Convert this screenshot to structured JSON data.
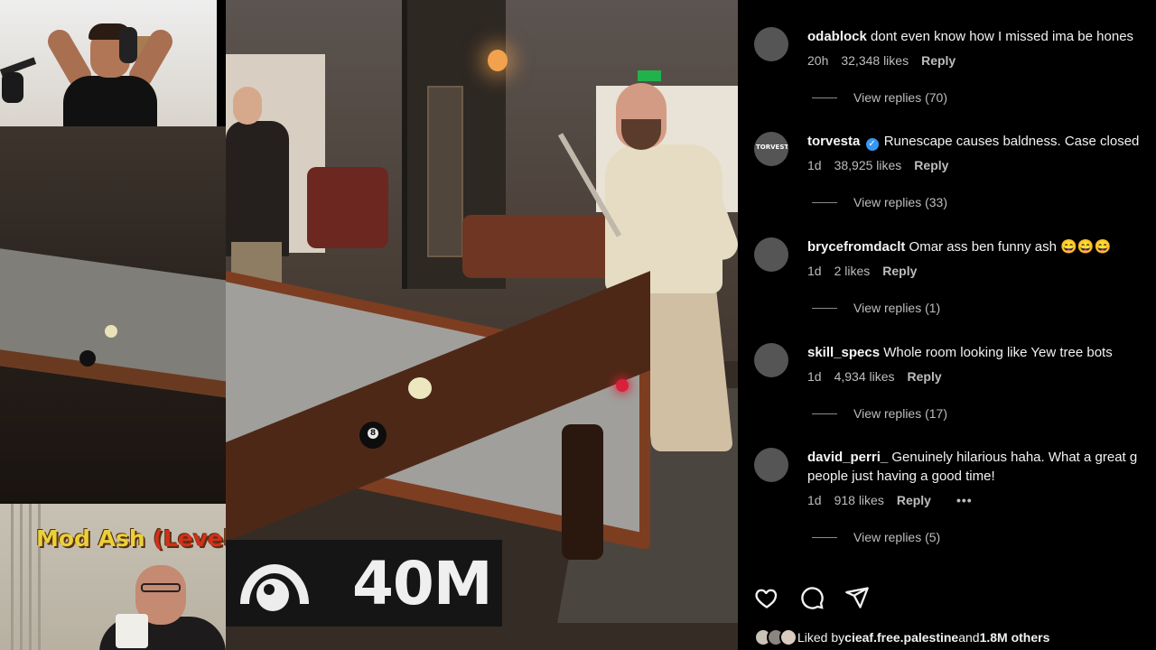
{
  "overlay": {
    "views_count": "40M",
    "mod_cam_title_main": "Mod Ash ",
    "mod_cam_title_accent": "(Level"
  },
  "comments": [
    {
      "username": "odablock",
      "verified": false,
      "text": "dont even know how I missed ima be hones",
      "time": "20h",
      "likes": "32,348 likes",
      "reply": "Reply",
      "view_replies": "View replies (70)"
    },
    {
      "username": "torvesta",
      "verified": true,
      "avatar_label": "TORVESTA",
      "text": "Runescape causes baldness. Case closed",
      "time": "1d",
      "likes": "38,925 likes",
      "reply": "Reply",
      "view_replies": "View replies (33)"
    },
    {
      "username": "brycefromdaclt",
      "verified": false,
      "text": "Omar ass ben funny ash 😄😄😄",
      "time": "1d",
      "likes": "2 likes",
      "reply": "Reply",
      "view_replies": "View replies (1)"
    },
    {
      "username": "skill_specs",
      "verified": false,
      "text": "Whole room looking like Yew tree bots",
      "time": "1d",
      "likes": "4,934 likes",
      "reply": "Reply",
      "view_replies": "View replies (17)"
    },
    {
      "username": "david_perri_",
      "verified": false,
      "text": "Genuinely hilarious haha. What a great g",
      "text_line2": "people just having a good time!",
      "time": "1d",
      "likes": "918 likes",
      "reply": "Reply",
      "more": "•••",
      "view_replies": "View replies (5)"
    }
  ],
  "liked_by": {
    "prefix": "Liked by ",
    "user": "cieaf.free.palestine",
    "middle": " and ",
    "others": "1.8M others"
  },
  "icons": [
    "heart-icon",
    "comment-icon",
    "share-icon",
    "eye-icon",
    "verified-badge-icon"
  ]
}
